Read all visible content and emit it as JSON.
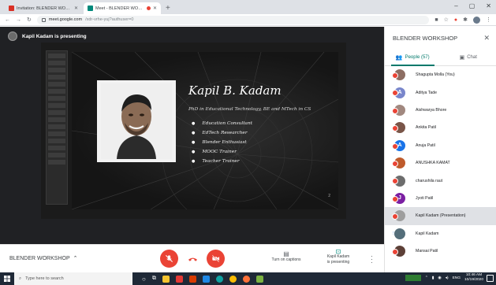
{
  "browser": {
    "tabs": [
      {
        "title": "Invitation: BLENDER WORKSHOP",
        "favicon_color": "#d93025",
        "active": false
      },
      {
        "title": "Meet - BLENDER WORKSHOP",
        "favicon_color": "#00897b",
        "active": true
      }
    ],
    "new_tab": "+",
    "url_host": "meet.google.com",
    "url_path": "/xdr-vrhe-yuj?authuser=0",
    "window_controls": [
      "–",
      "▢",
      "✕"
    ]
  },
  "meet": {
    "presenting_text": "Kapil Kadam is presenting",
    "slide": {
      "name": "Kapil B. Kadam",
      "subtitle": "PhD in Educational Technology, BE and MTech in CS",
      "bullets": [
        "Education Consultant",
        "EdTech Researcher",
        "Blender Enthusiast",
        "MOOC Trainer",
        "Teacher Trainer"
      ],
      "page_number": "2"
    },
    "bottom": {
      "meeting_name": "BLENDER WORKSHOP",
      "captions_label": "Turn on captions",
      "presenting_label_1": "Kapil Kadam",
      "presenting_label_2": "is presenting"
    }
  },
  "side_panel": {
    "title": "BLENDER WORKSHOP",
    "tabs": [
      {
        "label": "People (57)",
        "icon": "people-icon",
        "active": true
      },
      {
        "label": "Chat",
        "icon": "chat-icon",
        "active": false
      }
    ],
    "participants": [
      {
        "name": "Shagupta Molla (You)",
        "initial": "",
        "color": "#8d6e63",
        "muted": true
      },
      {
        "name": "Aditya Tade",
        "initial": "A",
        "color": "#7986cb",
        "muted": true
      },
      {
        "name": "Aishwarya Bhore",
        "initial": "",
        "color": "#a1887f",
        "muted": true
      },
      {
        "name": "Ankita Patil",
        "initial": "",
        "color": "#795548",
        "muted": true
      },
      {
        "name": "Anuja Patil",
        "initial": "A",
        "color": "#1a73e8",
        "muted": true
      },
      {
        "name": "ANUSHKA KAMAT",
        "initial": "",
        "color": "#bf5b2c",
        "muted": true
      },
      {
        "name": "charushila raut",
        "initial": "",
        "color": "#6d6d6d",
        "muted": true
      },
      {
        "name": "Jyoti Patil",
        "initial": "J",
        "color": "#7b1fa2",
        "muted": true
      },
      {
        "name": "Kapil Kadam (Presentation)",
        "initial": "",
        "color": "#9e9e9e",
        "muted": true,
        "highlight": true
      },
      {
        "name": "Kapil Kadam",
        "initial": "",
        "color": "#546e7a",
        "muted": false
      },
      {
        "name": "Mansai Patil",
        "initial": "",
        "color": "#5d4037",
        "muted": true
      }
    ]
  },
  "taskbar": {
    "search_placeholder": "Type here to search",
    "tray_lang": "ENG",
    "time": "10:46 AM",
    "date": "10/19/2020"
  }
}
